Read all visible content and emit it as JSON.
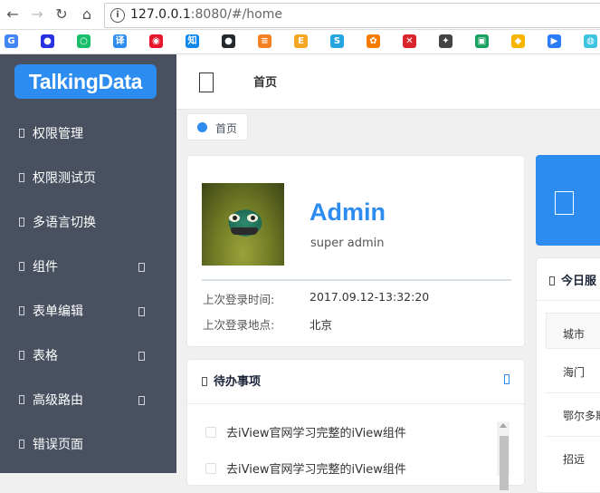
{
  "browser": {
    "url_host": "127.0.0.1",
    "url_rest": ":8080/#/home",
    "bookmarks": [
      {
        "icon": "google-icon",
        "glyph": "G",
        "color": "#4285f4"
      },
      {
        "icon": "baidu-icon",
        "glyph": "●",
        "color": "#2932e1"
      },
      {
        "icon": "green-app-icon",
        "glyph": "○",
        "color": "#19be6b"
      },
      {
        "icon": "translate-icon",
        "glyph": "译",
        "color": "#2d8cf0"
      },
      {
        "icon": "weibo-icon",
        "glyph": "◉",
        "color": "#e6162d"
      },
      {
        "icon": "zhihu-icon",
        "glyph": "知",
        "color": "#0f88eb"
      },
      {
        "icon": "github-icon",
        "glyph": "●",
        "color": "#24292e"
      },
      {
        "icon": "stackoverflow-icon",
        "glyph": "≡",
        "color": "#f48024"
      },
      {
        "icon": "e-app-icon",
        "glyph": "E",
        "color": "#f5a623"
      },
      {
        "icon": "swirl-app-icon",
        "glyph": "S",
        "color": "#26a6e0"
      },
      {
        "icon": "orange-flower-icon",
        "glyph": "✿",
        "color": "#f57c00"
      },
      {
        "icon": "red-x-icon",
        "glyph": "✕",
        "color": "#d9262c"
      },
      {
        "icon": "bird-icon",
        "glyph": "✦",
        "color": "#444444"
      },
      {
        "icon": "panda-icon",
        "glyph": "▣",
        "color": "#19a15f"
      },
      {
        "icon": "yellow-cat-icon",
        "glyph": "◆",
        "color": "#f7b500"
      },
      {
        "icon": "play-icon",
        "glyph": "▶",
        "color": "#2b7cf7"
      },
      {
        "icon": "robot-icon",
        "glyph": "◍",
        "color": "#3ec4e0"
      }
    ]
  },
  "logo": "TalkingData",
  "sidebar": {
    "items": [
      {
        "label": "权限管理",
        "has_arrow": false
      },
      {
        "label": "权限测试页",
        "has_arrow": false
      },
      {
        "label": "多语言切换",
        "has_arrow": false
      },
      {
        "label": "组件",
        "has_arrow": true
      },
      {
        "label": "表单编辑",
        "has_arrow": true
      },
      {
        "label": "表格",
        "has_arrow": true
      },
      {
        "label": "高级路由",
        "has_arrow": true
      },
      {
        "label": "错误页面",
        "has_arrow": false
      }
    ]
  },
  "header": {
    "title": "首页"
  },
  "tags": [
    {
      "label": "首页"
    }
  ],
  "user": {
    "name": "Admin",
    "role": "super admin",
    "last_login_time_label": "上次登录时间:",
    "last_login_time": "2017.09.12-13:32:20",
    "last_login_place_label": "上次登录地点:",
    "last_login_place": "北京"
  },
  "todo": {
    "title": "待办事项",
    "items": [
      "去iView官网学习完整的iView组件",
      "去iView官网学习完整的iView组件"
    ]
  },
  "right_panel": {
    "title": "今日服",
    "column_header": "城市",
    "rows": [
      "海门",
      "鄂尔多斯",
      "招远"
    ]
  },
  "colors": {
    "accent": "#2d8cf0",
    "sidebar": "#495060"
  }
}
